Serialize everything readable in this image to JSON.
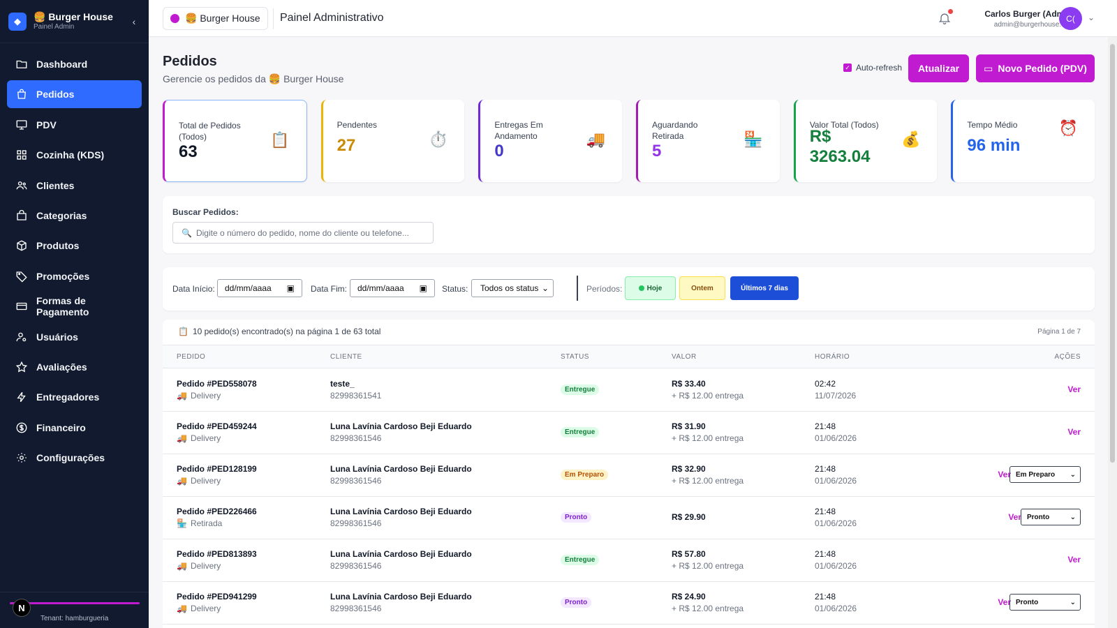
{
  "sidebar": {
    "brand_title": "🍔 Burger House",
    "brand_subtitle": "Painel Admin",
    "items": [
      {
        "label": "Dashboard",
        "icon": "folder-icon"
      },
      {
        "label": "Pedidos",
        "icon": "bag-icon",
        "active": true
      },
      {
        "label": "PDV",
        "icon": "monitor-icon"
      },
      {
        "label": "Cozinha (KDS)",
        "icon": "grid-icon"
      },
      {
        "label": "Clientes",
        "icon": "users-icon"
      },
      {
        "label": "Categorias",
        "icon": "shopping-bag-icon"
      },
      {
        "label": "Produtos",
        "icon": "box-icon"
      },
      {
        "label": "Promoções",
        "icon": "tag-icon"
      },
      {
        "label": "Formas de Pagamento",
        "icon": "card-icon"
      },
      {
        "label": "Usuários",
        "icon": "user-cog-icon"
      },
      {
        "label": "Avaliações",
        "icon": "star-icon"
      },
      {
        "label": "Entregadores",
        "icon": "bolt-icon"
      },
      {
        "label": "Financeiro",
        "icon": "dollar-icon"
      },
      {
        "label": "Configurações",
        "icon": "gear-icon"
      }
    ],
    "footer_avatar": "N",
    "tenant": "Tenant: hamburgueria"
  },
  "topbar": {
    "store_name": "🍔 Burger House",
    "title": "Painel Administrativo",
    "user_name": "Carlos Burger (Admin)",
    "user_email": "admin@burgerhouse.com",
    "user_initials": "C("
  },
  "page": {
    "title": "Pedidos",
    "subtitle": "Gerencie os pedidos da 🍔 Burger House",
    "autorefresh_label": "Auto-refresh",
    "autorefresh_checked": true,
    "update_button": "Atualizar",
    "new_order_button": "Novo Pedido (PDV)"
  },
  "stats": [
    {
      "label": "Total de Pedidos (Todos)",
      "value": "63",
      "icon": "📋",
      "color": "#c11bd1",
      "value_color": "#111827"
    },
    {
      "label": "Pendentes",
      "value": "27",
      "icon": "⏱️",
      "color": "#eab308",
      "value_color": "#ca8a04"
    },
    {
      "label": "Entregas Em Andamento",
      "value": "0",
      "icon": "🚚",
      "color": "#6d28d9",
      "value_color": "#4338ca"
    },
    {
      "label": "Aguardando Retirada",
      "value": "5",
      "icon": "🏪",
      "color": "#a21caf",
      "value_color": "#9333ea"
    },
    {
      "label": "Valor Total (Todos)",
      "value": "R$ 3263.04",
      "icon": "💰",
      "color": "#16a34a",
      "value_color": "#15803d"
    },
    {
      "label": "Tempo Médio",
      "value": "96 min",
      "icon": "⏰",
      "color": "#2563eb",
      "value_color": "#2563eb"
    }
  ],
  "search": {
    "label": "Buscar Pedidos:",
    "placeholder": "Digite o número do pedido, nome do cliente ou telefone..."
  },
  "filters": {
    "start_label": "Data Início:",
    "start_value": "dd/mm/aaaa",
    "end_label": "Data Fim:",
    "end_value": "dd/mm/aaaa",
    "status_label": "Status:",
    "status_value": "Todos os status",
    "periods_label": "Períodos:",
    "chips": [
      {
        "label": "Hoje",
        "bg": "#dcfce7",
        "fg": "#166534",
        "border": "#86efac"
      },
      {
        "label": "Ontem",
        "bg": "#fef9c3",
        "fg": "#854d0e",
        "border": "#fde047"
      },
      {
        "label": "Últimos 7 dias",
        "bg": "#1d4ed8",
        "fg": "#ffffff",
        "border": "#1d4ed8"
      }
    ]
  },
  "table": {
    "info": "10 pedido(s) encontrado(s) na página 1 de 63 total",
    "page_info": "Página 1 de 7",
    "headers": [
      "PEDIDO",
      "CLIENTE",
      "STATUS",
      "VALOR",
      "HORÁRIO",
      "AÇÕES"
    ],
    "rows": [
      {
        "order": "Pedido #PED558078",
        "type": "Delivery",
        "type_icon": "🚚",
        "name": "teste_",
        "phone": "82998361541",
        "status": "Entregue",
        "status_class": "b-entregue",
        "value": "R$ 33.40",
        "fee": "+ R$ 12.00 entrega",
        "time": "02:42",
        "date": "11/07/2026",
        "action": "Ver",
        "select": ""
      },
      {
        "order": "Pedido #PED459244",
        "type": "Delivery",
        "type_icon": "🚚",
        "name": "Luna Lavínia Cardoso Beji Eduardo",
        "phone": "82998361546",
        "status": "Entregue",
        "status_class": "b-entregue",
        "value": "R$ 31.90",
        "fee": "+ R$ 12.00 entrega",
        "time": "21:48",
        "date": "01/06/2026",
        "action": "Ver",
        "select": ""
      },
      {
        "order": "Pedido #PED128199",
        "type": "Delivery",
        "type_icon": "🚚",
        "name": "Luna Lavínia Cardoso Beji Eduardo",
        "phone": "82998361546",
        "status": "Em Preparo",
        "status_class": "b-preparo",
        "value": "R$ 32.90",
        "fee": "+ R$ 12.00 entrega",
        "time": "21:48",
        "date": "01/06/2026",
        "action": "Ver",
        "select": "Em Preparo"
      },
      {
        "order": "Pedido #PED226466",
        "type": "Retirada",
        "type_icon": "🏪",
        "name": "Luna Lavínia Cardoso Beji Eduardo",
        "phone": "82998361546",
        "status": "Pronto",
        "status_class": "b-pronto",
        "value": "R$ 29.90",
        "fee": "",
        "time": "21:48",
        "date": "01/06/2026",
        "action": "Ver",
        "select": "Pronto"
      },
      {
        "order": "Pedido #PED813893",
        "type": "Delivery",
        "type_icon": "🚚",
        "name": "Luna Lavínia Cardoso Beji Eduardo",
        "phone": "82998361546",
        "status": "Entregue",
        "status_class": "b-entregue",
        "value": "R$ 57.80",
        "fee": "+ R$ 12.00 entrega",
        "time": "21:48",
        "date": "01/06/2026",
        "action": "Ver",
        "select": ""
      },
      {
        "order": "Pedido #PED941299",
        "type": "Delivery",
        "type_icon": "🚚",
        "name": "Luna Lavínia Cardoso Beji Eduardo",
        "phone": "82998361546",
        "status": "Pronto",
        "status_class": "b-pronto",
        "value": "R$ 24.90",
        "fee": "+ R$ 12.00 entrega",
        "time": "21:48",
        "date": "01/06/2026",
        "action": "Ver",
        "select": "Pronto"
      }
    ]
  }
}
